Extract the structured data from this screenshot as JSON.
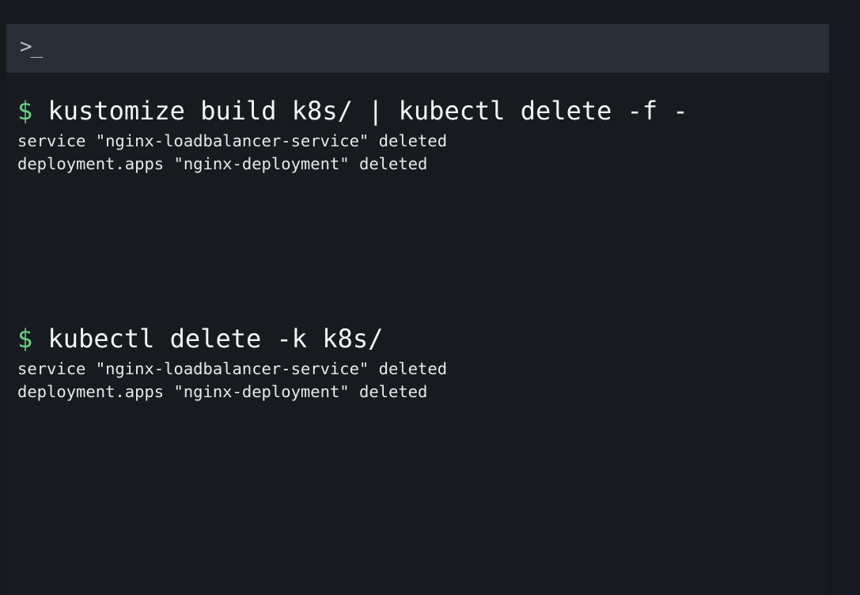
{
  "terminal": {
    "prompt_icon": ">_",
    "prompt_symbol": "$",
    "sessions": [
      {
        "command": "kustomize build k8s/ | kubectl delete -f -",
        "output": [
          "service \"nginx-loadbalancer-service\" deleted",
          "deployment.apps \"nginx-deployment\" deleted"
        ]
      },
      {
        "command": "kubectl delete -k k8s/",
        "output": [
          "service \"nginx-loadbalancer-service\" deleted",
          "deployment.apps \"nginx-deployment\" deleted"
        ]
      }
    ]
  },
  "colors": {
    "background": "#16191e",
    "title_bar": "#272e38",
    "prompt_green": "#6bd184",
    "text": "#eceff2"
  }
}
